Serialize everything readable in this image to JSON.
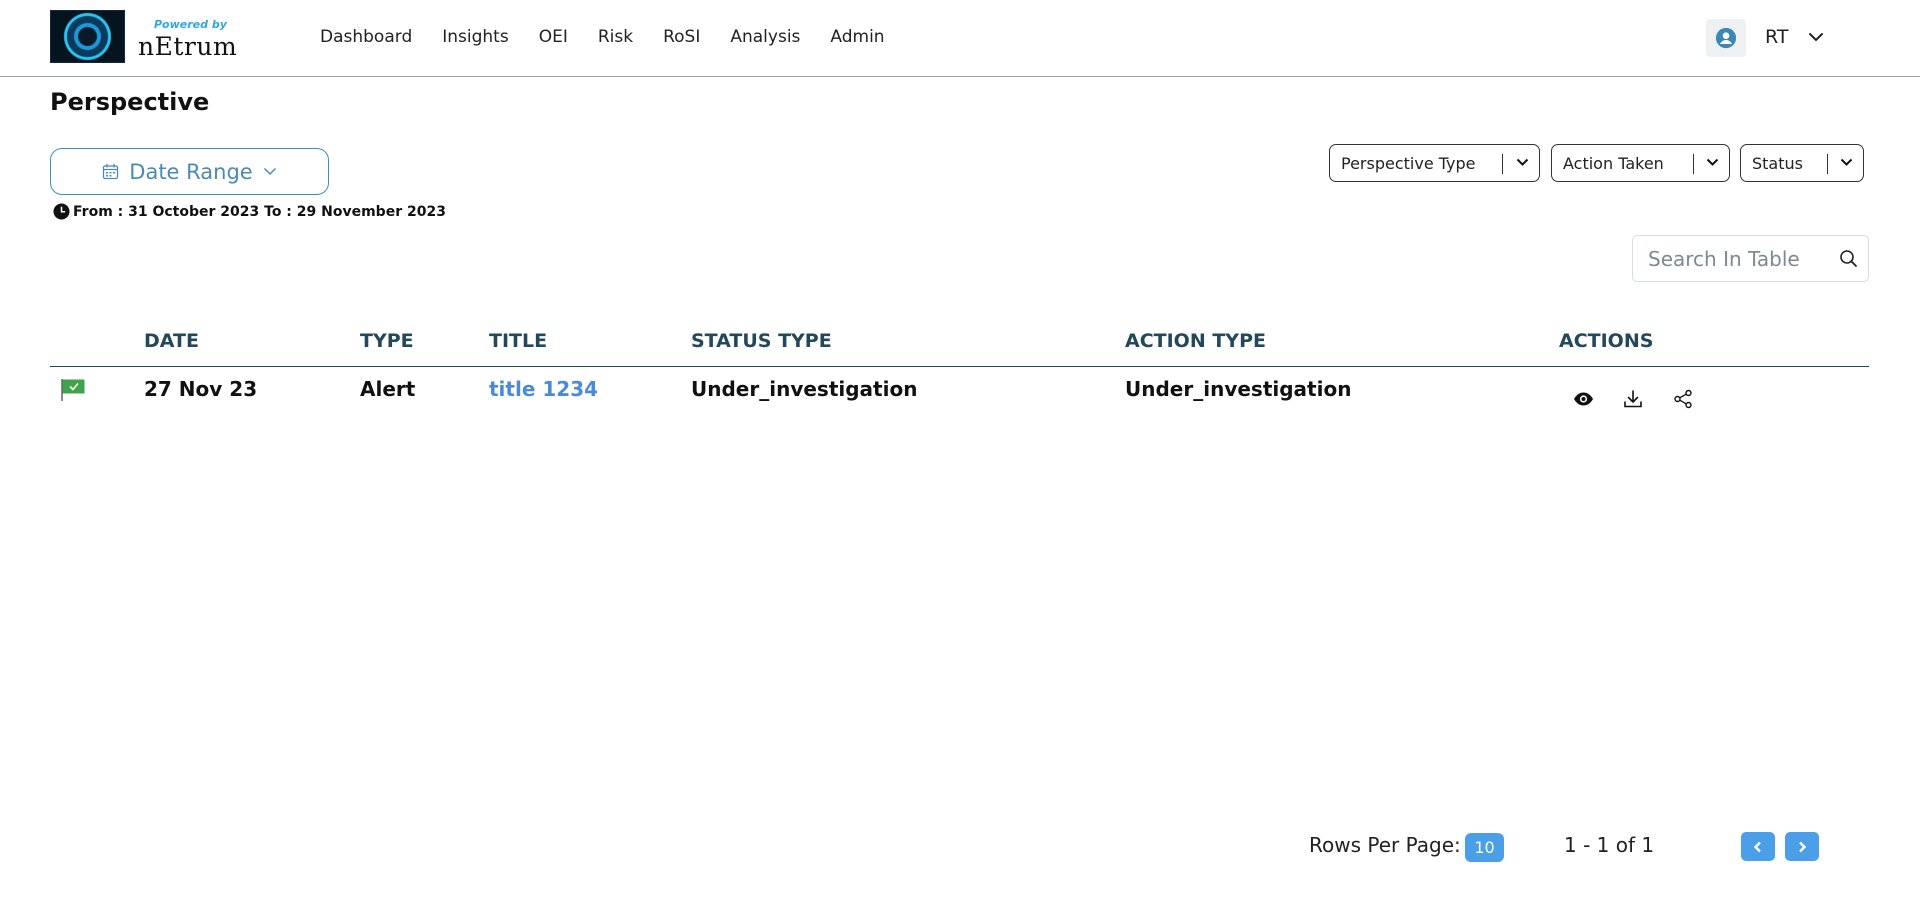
{
  "header": {
    "logo": {
      "powered_by": "Powered by",
      "brand": "nEtrum"
    },
    "nav": [
      "Dashboard",
      "Insights",
      "OEI",
      "Risk",
      "RoSI",
      "Analysis",
      "Admin"
    ],
    "user": {
      "initials": "RT",
      "avatar_icon": "user-circle-icon",
      "menu_icon": "chevron-down-icon"
    }
  },
  "page": {
    "title": "Perspective"
  },
  "date_filter": {
    "label": "Date Range",
    "range_text": "From : 31 October 2023 To : 29 November 2023"
  },
  "filters": [
    {
      "label": "Perspective Type"
    },
    {
      "label": "Action Taken"
    },
    {
      "label": "Status"
    }
  ],
  "search": {
    "placeholder": "Search In Table",
    "value": ""
  },
  "table": {
    "columns": [
      "DATE",
      "TYPE",
      "TITLE",
      "STATUS TYPE",
      "ACTION TYPE",
      "ACTIONS"
    ],
    "rows": [
      {
        "flag_icon": "green-flag-icon",
        "date": "27 Nov 23",
        "type": "Alert",
        "title": "title 1234",
        "status_type": "Under_investigation",
        "action_type": "Under_investigation",
        "actions": [
          "view-icon",
          "download-icon",
          "share-icon"
        ]
      }
    ]
  },
  "pagination": {
    "rows_per_page_label": "Rows Per Page:",
    "rows_per_page": "10",
    "range": "1 - 1 of 1"
  },
  "colors": {
    "accent": "#4a9fe8",
    "header_text": "#22485a",
    "link": "#4a8ad9",
    "date_range_border": "#3d8fb4"
  }
}
